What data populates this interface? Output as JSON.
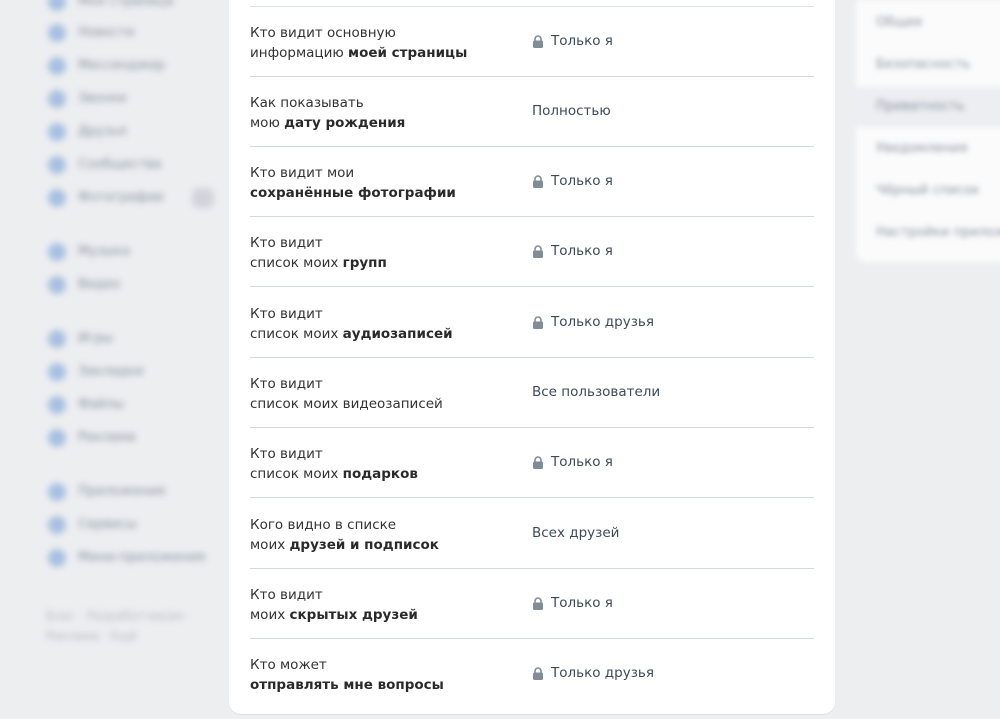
{
  "sidebar": {
    "items": [
      {
        "label": "Моя страница",
        "icon": "user-icon"
      },
      {
        "label": "Новости",
        "icon": "news-icon"
      },
      {
        "label": "Мессенджер",
        "icon": "message-icon"
      },
      {
        "label": "Звонки",
        "icon": "phone-icon"
      },
      {
        "label": "Друзья",
        "icon": "friends-icon"
      },
      {
        "label": "Сообщества",
        "icon": "groups-icon"
      },
      {
        "label": "Фотографии",
        "icon": "photo-icon"
      }
    ],
    "items2": [
      {
        "label": "Музыка",
        "icon": "music-icon"
      },
      {
        "label": "Видео",
        "icon": "video-icon"
      }
    ],
    "items3": [
      {
        "label": "Игры",
        "icon": "games-icon"
      },
      {
        "label": "Закладки",
        "icon": "bookmark-icon"
      },
      {
        "label": "Файлы",
        "icon": "file-icon"
      },
      {
        "label": "Реклама",
        "icon": "ads-icon"
      }
    ],
    "items4": [
      {
        "label": "Приложения",
        "icon": "app-icon"
      },
      {
        "label": "Сервисы",
        "icon": "service-icon"
      },
      {
        "label": "Мини-приложения",
        "icon": "mini-app-icon"
      }
    ],
    "footer": "Блог · Разработчикам · Реклама · Ещё"
  },
  "right_menu": {
    "items": [
      {
        "label": "Общее"
      },
      {
        "label": "Безопасность"
      },
      {
        "label": "Приватность"
      },
      {
        "label": "Уведомления"
      },
      {
        "label": "Чёрный список"
      },
      {
        "label": "Настройки приложений"
      }
    ]
  },
  "privacy": {
    "rows": [
      {
        "line1": "Кто видит основную",
        "line2_plain": "информацию ",
        "line2_bold": "моей страницы",
        "value": "Только я",
        "locked": true
      },
      {
        "line1": "Как показывать",
        "line2_plain": "мою ",
        "line2_bold": "дату рождения",
        "value": "Полностью",
        "locked": false
      },
      {
        "line1": "Кто видит мои",
        "line2_plain": "",
        "line2_bold": "сохранённые фотографии",
        "value": "Только я",
        "locked": true
      },
      {
        "line1": "Кто видит",
        "line2_plain": "список моих ",
        "line2_bold": "групп",
        "value": "Только я",
        "locked": true
      },
      {
        "line1": "Кто видит",
        "line2_plain": "список моих ",
        "line2_bold": "аудиозаписей",
        "value": "Только друзья",
        "locked": true
      },
      {
        "line1": "Кто видит",
        "line2_plain": "список моих видеозаписей",
        "line2_bold": "",
        "value": "Все пользователи",
        "locked": false
      },
      {
        "line1": "Кто видит",
        "line2_plain": "список моих ",
        "line2_bold": "подарков",
        "value": "Только я",
        "locked": true
      },
      {
        "line1": "Кого видно в списке",
        "line2_plain": "моих ",
        "line2_bold": "друзей и подписок",
        "value": "Всех друзей",
        "locked": false
      },
      {
        "line1": "Кто видит",
        "line2_plain": "моих ",
        "line2_bold": "скрытых друзей",
        "value": "Только я",
        "locked": true
      },
      {
        "line1": "Кто может",
        "line2_plain": "",
        "line2_bold": "отправлять мне вопросы",
        "value": "Только друзья",
        "locked": true
      }
    ]
  },
  "colors": {
    "background": "#edeef0",
    "card": "#ffffff",
    "separator": "#d3d9e0",
    "lock": "#818c99",
    "value_text": "#3d4a5a"
  }
}
